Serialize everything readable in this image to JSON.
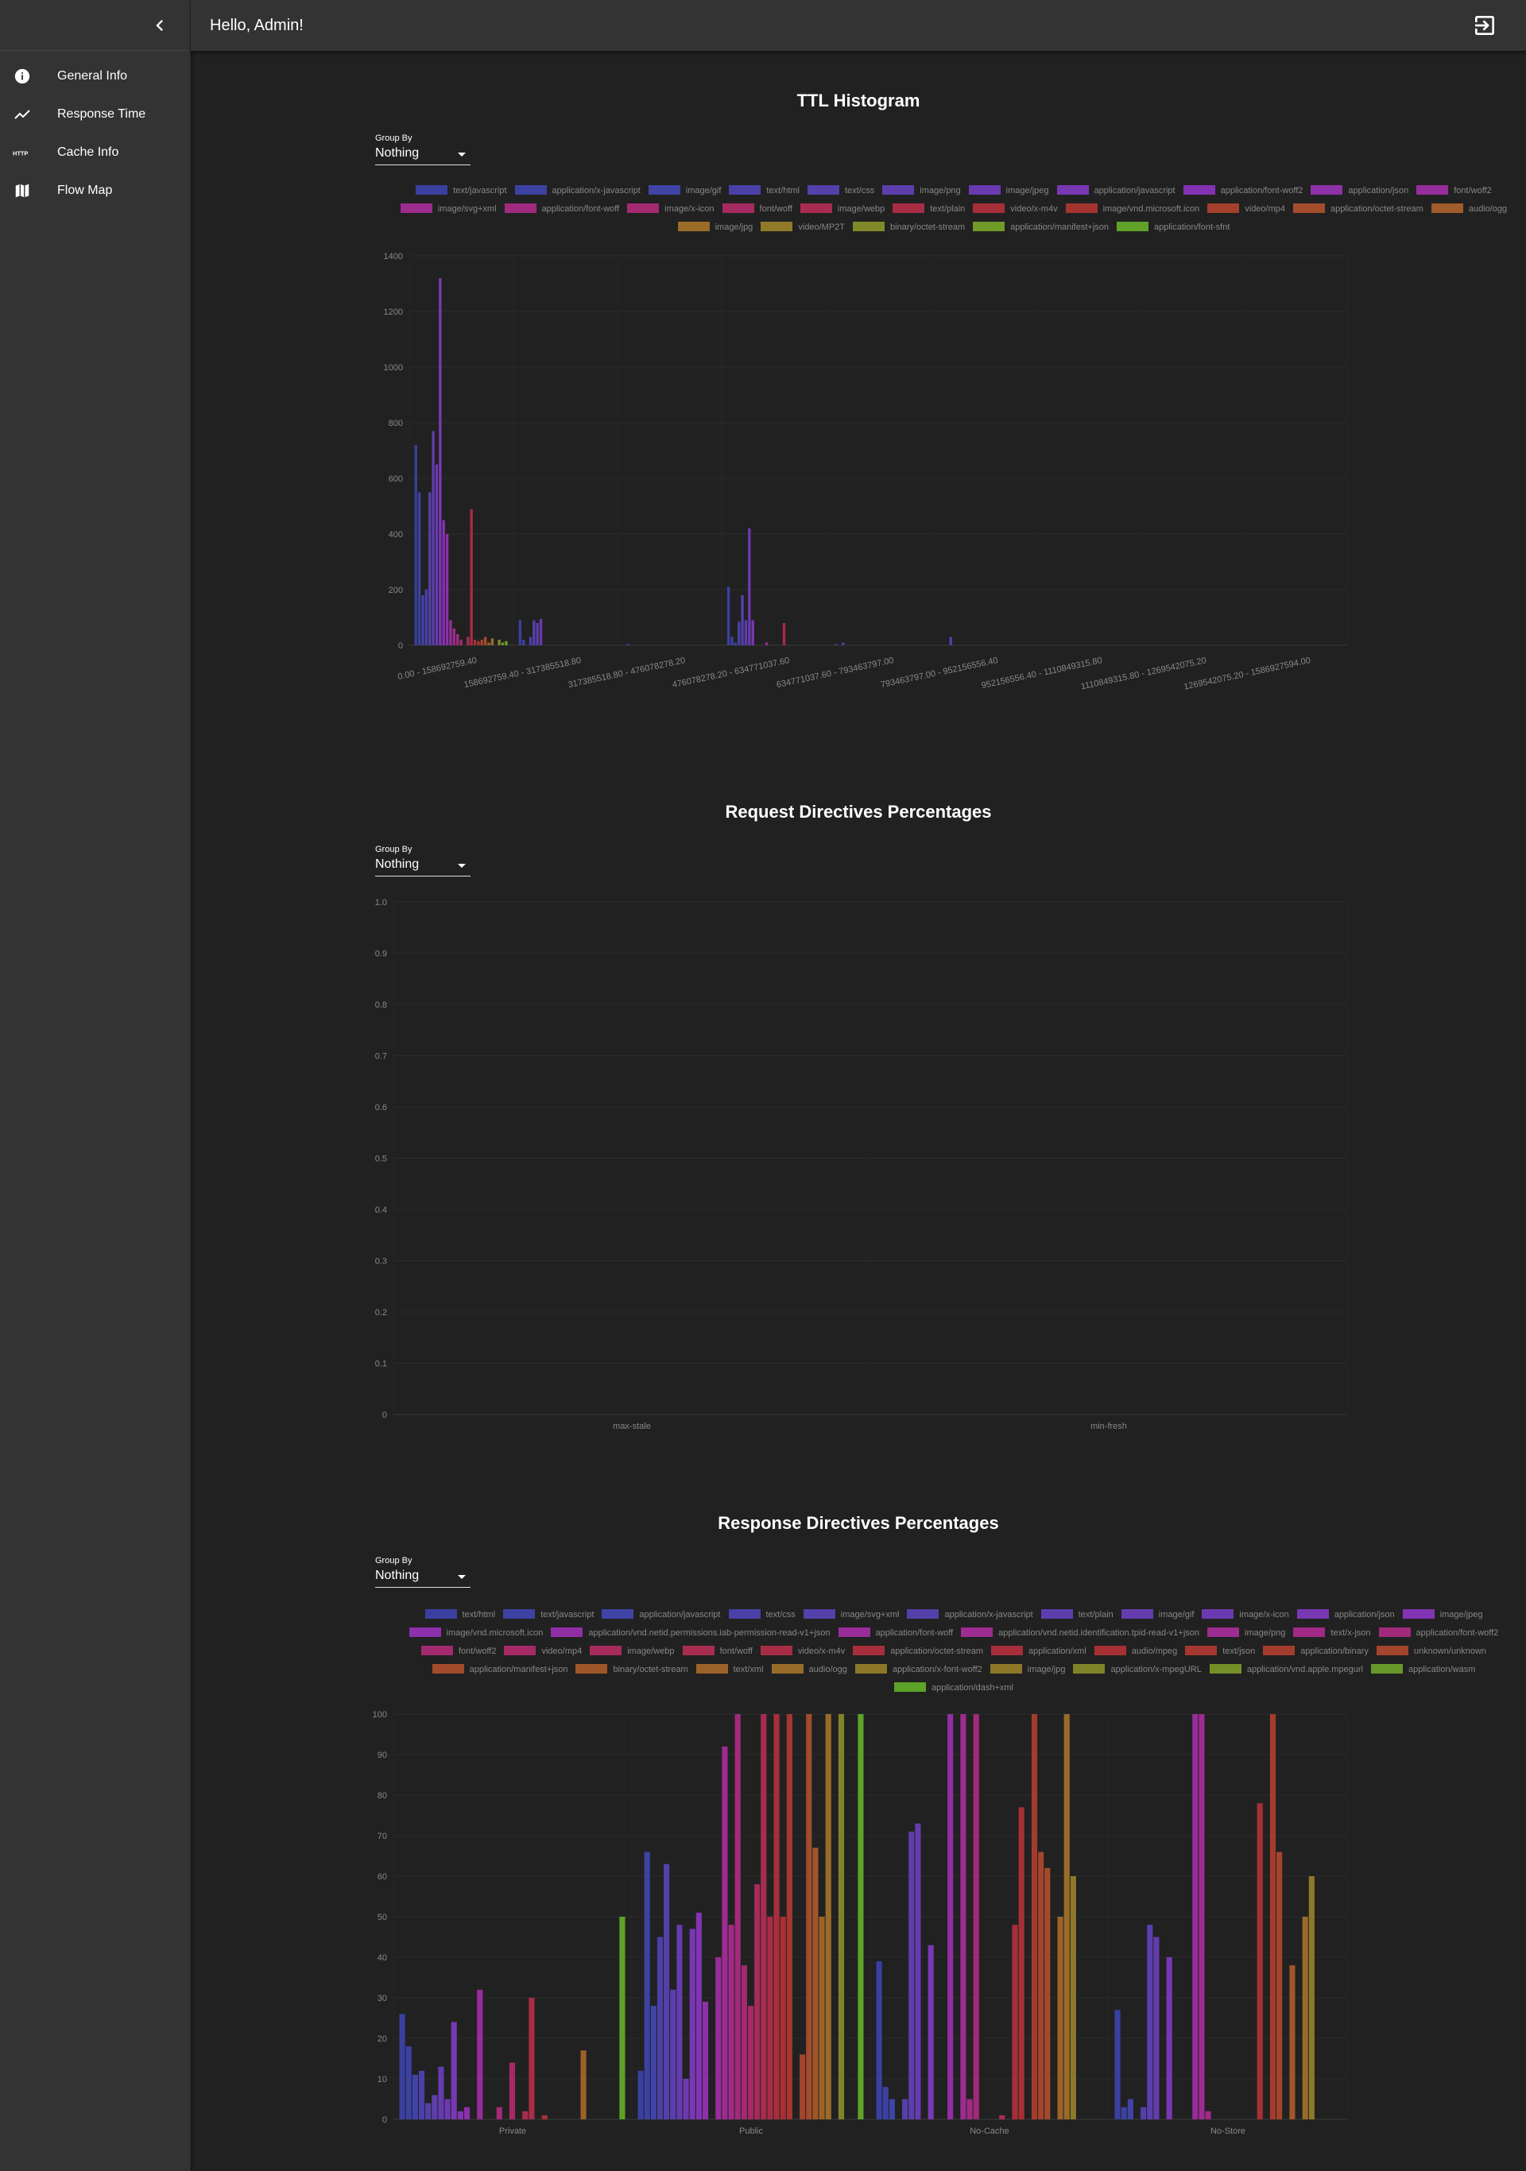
{
  "app": {
    "greeting": "Hello, Admin!",
    "nav": [
      {
        "label": "General Info",
        "icon": "info-icon"
      },
      {
        "label": "Response Time",
        "icon": "trending-up-icon"
      },
      {
        "label": "Cache Info",
        "icon": "http-icon"
      },
      {
        "label": "Flow Map",
        "icon": "map-icon"
      }
    ]
  },
  "sections": [
    {
      "title": "TTL Histogram",
      "group_by_label": "Group By",
      "group_by_value": "Nothing"
    },
    {
      "title": "Request Directives Percentages",
      "group_by_label": "Group By",
      "group_by_value": "Nothing"
    },
    {
      "title": "Response Directives Percentages",
      "group_by_label": "Group By",
      "group_by_value": "Nothing"
    }
  ],
  "chart_data": [
    {
      "type": "bar",
      "title": "TTL Histogram",
      "xlabel": "",
      "ylabel": "",
      "ylim": [
        0,
        1400
      ],
      "yticks": [
        0,
        200,
        400,
        600,
        800,
        1000,
        1200,
        1400
      ],
      "categories": [
        "0.00 - 158692759.40",
        "158692759.40 - 317385518.80",
        "317385518.80 - 476078278.20",
        "476078278.20 - 634771037.60",
        "634771037.60 - 793463797.00",
        "793463797.00 - 952156556.40",
        "952156556.40 - 1110849315.80",
        "1110849315.80 - 1269542075.20",
        "1269542075.20 - 1586927594.00"
      ],
      "series": [
        {
          "name": "text/javascript",
          "values": [
            720,
            90,
            0,
            210,
            0,
            0,
            0,
            0,
            0
          ]
        },
        {
          "name": "application/x-javascript",
          "values": [
            550,
            20,
            5,
            30,
            5,
            0,
            0,
            0,
            0
          ]
        },
        {
          "name": "image/gif",
          "values": [
            180,
            0,
            0,
            10,
            0,
            0,
            0,
            0,
            0
          ]
        },
        {
          "name": "text/html",
          "values": [
            200,
            30,
            0,
            85,
            10,
            0,
            0,
            0,
            0
          ]
        },
        {
          "name": "text/css",
          "values": [
            550,
            90,
            0,
            180,
            0,
            30,
            0,
            0,
            0
          ]
        },
        {
          "name": "image/png",
          "values": [
            770,
            80,
            0,
            90,
            0,
            0,
            0,
            0,
            0
          ]
        },
        {
          "name": "image/jpeg",
          "values": [
            650,
            95,
            0,
            420,
            0,
            0,
            0,
            0,
            0
          ]
        },
        {
          "name": "application/javascript",
          "values": [
            1320,
            0,
            0,
            90,
            0,
            0,
            0,
            0,
            0
          ]
        },
        {
          "name": "application/font-woff2",
          "values": [
            450,
            0,
            0,
            0,
            0,
            0,
            0,
            0,
            0
          ]
        },
        {
          "name": "application/json",
          "values": [
            400,
            0,
            0,
            0,
            0,
            0,
            0,
            0,
            0
          ]
        },
        {
          "name": "font/woff2",
          "values": [
            90,
            0,
            0,
            0,
            0,
            0,
            0,
            0,
            0
          ]
        },
        {
          "name": "image/svg+xml",
          "values": [
            60,
            0,
            0,
            10,
            0,
            0,
            0,
            0,
            0
          ]
        },
        {
          "name": "application/font-woff",
          "values": [
            40,
            0,
            0,
            0,
            0,
            0,
            0,
            0,
            0
          ]
        },
        {
          "name": "image/x-icon",
          "values": [
            20,
            0,
            0,
            0,
            0,
            0,
            0,
            0,
            0
          ]
        },
        {
          "name": "font/woff",
          "values": [
            0,
            0,
            0,
            0,
            0,
            0,
            0,
            0,
            0
          ]
        },
        {
          "name": "image/webp",
          "values": [
            30,
            0,
            0,
            0,
            0,
            0,
            0,
            0,
            0
          ]
        },
        {
          "name": "text/plain",
          "values": [
            490,
            0,
            0,
            80,
            0,
            0,
            0,
            0,
            0
          ]
        },
        {
          "name": "video/x-m4v",
          "values": [
            20,
            0,
            0,
            0,
            0,
            0,
            0,
            0,
            0
          ]
        },
        {
          "name": "image/vnd.microsoft.icon",
          "values": [
            15,
            0,
            0,
            0,
            0,
            0,
            0,
            0,
            0
          ]
        },
        {
          "name": "video/mp4",
          "values": [
            20,
            0,
            0,
            0,
            0,
            0,
            0,
            0,
            0
          ]
        },
        {
          "name": "application/octet-stream",
          "values": [
            30,
            0,
            0,
            0,
            0,
            0,
            0,
            0,
            0
          ]
        },
        {
          "name": "audio/ogg",
          "values": [
            10,
            0,
            0,
            0,
            0,
            0,
            0,
            0,
            0
          ]
        },
        {
          "name": "image/jpg",
          "values": [
            25,
            0,
            0,
            0,
            0,
            0,
            0,
            0,
            0
          ]
        },
        {
          "name": "video/MP2T",
          "values": [
            0,
            0,
            0,
            0,
            0,
            0,
            0,
            0,
            0
          ]
        },
        {
          "name": "binary/octet-stream",
          "values": [
            20,
            0,
            0,
            0,
            0,
            0,
            0,
            0,
            0
          ]
        },
        {
          "name": "application/manifest+json",
          "values": [
            10,
            0,
            0,
            0,
            0,
            0,
            0,
            0,
            0
          ]
        },
        {
          "name": "application/font-sfnt",
          "values": [
            15,
            0,
            0,
            0,
            0,
            0,
            0,
            0,
            0
          ]
        }
      ],
      "colors": [
        "#3a40a0",
        "#3c42a2",
        "#4044a6",
        "#4a40a8",
        "#5440aa",
        "#5e3eac",
        "#6a3ab0",
        "#7838b4",
        "#8432b4",
        "#8e30a8",
        "#962e9c",
        "#9c2c8e",
        "#a02a80",
        "#a42a70",
        "#a62a62",
        "#a82c52",
        "#a82c44",
        "#a62e38",
        "#a43430",
        "#a4402c",
        "#a44c2c",
        "#a05c2a",
        "#9a6c28",
        "#907a28",
        "#808a28",
        "#709a28",
        "#60a228"
      ],
      "legend_position": "top",
      "grid": true
    },
    {
      "type": "bar",
      "title": "Request Directives Percentages",
      "xlabel": "",
      "ylabel": "",
      "ylim": [
        0,
        1.0
      ],
      "yticks": [
        "0",
        "0.1",
        "0.2",
        "0.3",
        "0.4",
        "0.5",
        "0.6",
        "0.7",
        "0.8",
        "0.9",
        "1.0"
      ],
      "categories": [
        "max-stale",
        "min-fresh"
      ],
      "series": [],
      "grid": true
    },
    {
      "type": "bar",
      "title": "Response Directives Percentages",
      "xlabel": "",
      "ylabel": "",
      "ylim": [
        0,
        100
      ],
      "yticks": [
        0,
        10,
        20,
        30,
        40,
        50,
        60,
        70,
        80,
        90,
        100
      ],
      "categories": [
        "Private",
        "Public",
        "No-Cache",
        "No-Store"
      ],
      "series": [
        {
          "name": "text/html",
          "values": [
            26,
            12,
            39,
            27
          ]
        },
        {
          "name": "text/javascript",
          "values": [
            18,
            66,
            8,
            3
          ]
        },
        {
          "name": "application/javascript",
          "values": [
            11,
            28,
            5,
            5
          ]
        },
        {
          "name": "text/css",
          "values": [
            12,
            45,
            0,
            0
          ]
        },
        {
          "name": "image/svg+xml",
          "values": [
            4,
            63,
            5,
            3
          ]
        },
        {
          "name": "application/x-javascript",
          "values": [
            6,
            32,
            71,
            48
          ]
        },
        {
          "name": "text/plain",
          "values": [
            13,
            48,
            73,
            45
          ]
        },
        {
          "name": "image/gif",
          "values": [
            5,
            10,
            0,
            0
          ]
        },
        {
          "name": "image/x-icon",
          "values": [
            24,
            47,
            43,
            40
          ]
        },
        {
          "name": "application/json",
          "values": [
            2,
            51,
            0,
            0
          ]
        },
        {
          "name": "text/xml",
          "values": [
            3,
            29,
            0,
            0
          ]
        },
        {
          "name": "image/jpeg",
          "values": [
            0,
            0,
            100,
            0
          ]
        },
        {
          "name": "image/vnd.microsoft.icon",
          "values": [
            32,
            40,
            0,
            100
          ]
        },
        {
          "name": "application/vnd.netid.permissions.iab-permission-read-v1+json",
          "values": [
            0,
            92,
            100,
            100
          ]
        },
        {
          "name": "application/font-woff",
          "values": [
            0,
            48,
            5,
            2
          ]
        },
        {
          "name": "application/vnd.netid.identification.tpid-read-v1+json",
          "values": [
            3,
            100,
            100,
            0
          ]
        },
        {
          "name": "image/png",
          "values": [
            0,
            38,
            0,
            0
          ]
        },
        {
          "name": "text/x-json",
          "values": [
            14,
            28,
            0,
            0
          ]
        },
        {
          "name": "application/font-woff2",
          "values": [
            0,
            58,
            0,
            0
          ]
        },
        {
          "name": "font/woff2",
          "values": [
            2,
            100,
            1,
            0
          ]
        },
        {
          "name": "video/mp4",
          "values": [
            30,
            50,
            0,
            0
          ]
        },
        {
          "name": "image/webp",
          "values": [
            0,
            100,
            48,
            0
          ]
        },
        {
          "name": "font/woff",
          "values": [
            1,
            50,
            77,
            78
          ]
        },
        {
          "name": "video/x-m4v",
          "values": [
            0,
            100,
            0,
            0
          ]
        },
        {
          "name": "application/octet-stream",
          "values": [
            0,
            0,
            100,
            100
          ]
        },
        {
          "name": "application/xml",
          "values": [
            0,
            16,
            66,
            66
          ]
        },
        {
          "name": "audio/mpeg",
          "values": [
            0,
            100,
            62,
            0
          ]
        },
        {
          "name": "text/json",
          "values": [
            0,
            67,
            0,
            38
          ]
        },
        {
          "name": "application/binary",
          "values": [
            17,
            50,
            50,
            0
          ]
        },
        {
          "name": "unknown/unknown",
          "values": [
            0,
            100,
            100,
            50
          ]
        },
        {
          "name": "application/manifest+json",
          "values": [
            0,
            0,
            60,
            60
          ]
        },
        {
          "name": "binary/octet-stream",
          "values": [
            0,
            100,
            0,
            0
          ]
        },
        {
          "name": "text/xml",
          "values": [
            0,
            0,
            0,
            0
          ]
        },
        {
          "name": "audio/ogg",
          "values": [
            0,
            0,
            0,
            0
          ]
        },
        {
          "name": "application/x-font-woff2",
          "values": [
            50,
            100,
            0,
            0
          ]
        }
      ],
      "colors": [
        "#3a40a0",
        "#3c42a2",
        "#4044a6",
        "#4a40a8",
        "#5440aa",
        "#5c3eac",
        "#643cae",
        "#6c3ab0",
        "#7838b4",
        "#8234b4",
        "#8c30ac",
        "#922ea4",
        "#982c9a",
        "#9c2c90",
        "#a02a86",
        "#a22a7a",
        "#a42a70",
        "#a62a66",
        "#a62a5a",
        "#a82c50",
        "#a82c46",
        "#a82e3c",
        "#a63034",
        "#a63630",
        "#a43c2e",
        "#a4442c",
        "#a24c2c",
        "#a0562a",
        "#9c6228",
        "#986c28",
        "#8c7828",
        "#808428",
        "#748e28",
        "#689828",
        "#5ea228"
      ],
      "legend_position": "top",
      "grid": true
    }
  ],
  "legends": {
    "ttl": [
      "text/javascript",
      "application/x-javascript",
      "image/gif",
      "text/html",
      "text/css",
      "image/png",
      "image/jpeg",
      "application/javascript",
      "application/font-woff2",
      "application/json",
      "font/woff2",
      "image/svg+xml",
      "application/font-woff",
      "image/x-icon",
      "font/woff",
      "image/webp",
      "text/plain",
      "video/x-m4v",
      "image/vnd.microsoft.icon",
      "video/mp4",
      "application/octet-stream",
      "audio/ogg",
      "image/jpg",
      "video/MP2T",
      "binary/octet-stream",
      "application/manifest+json",
      "application/font-sfnt"
    ],
    "response": [
      "text/html",
      "text/javascript",
      "application/javascript",
      "text/css",
      "image/svg+xml",
      "application/x-javascript",
      "text/plain",
      "image/gif",
      "image/x-icon",
      "application/json",
      "image/jpeg",
      "image/vnd.microsoft.icon",
      "application/vnd.netid.permissions.iab-permission-read-v1+json",
      "application/font-woff",
      "application/vnd.netid.identification.tpid-read-v1+json",
      "image/png",
      "text/x-json",
      "application/font-woff2",
      "font/woff2",
      "video/mp4",
      "image/webp",
      "font/woff",
      "video/x-m4v",
      "application/octet-stream",
      "application/xml",
      "audio/mpeg",
      "text/json",
      "application/binary",
      "unknown/unknown",
      "application/manifest+json",
      "binary/octet-stream",
      "text/xml",
      "audio/ogg",
      "application/x-font-woff2",
      "image/jpg",
      "application/x-mpegURL",
      "application/vnd.apple.mpegurl",
      "application/wasm",
      "application/dash+xml"
    ]
  }
}
